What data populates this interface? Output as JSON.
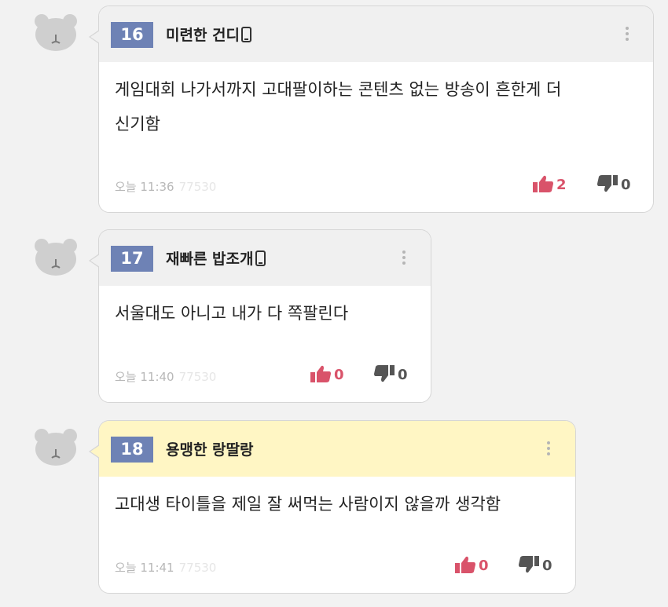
{
  "colors": {
    "number_badge": "#6e82b5",
    "highlight": "#fff6c4",
    "like": "#d9536a",
    "dislike": "#555555"
  },
  "comments": [
    {
      "number": "16",
      "nickname": "미련한 건디",
      "mobile_icon": "phone-icon",
      "content_lines": [
        "게임대회 나가서까지 고대팔이하는 콘텐츠 없는 방송이 흔한게 더",
        "신기함"
      ],
      "time": "오늘 11:36",
      "hits": "77530",
      "likes": "2",
      "dislikes": "0"
    },
    {
      "number": "17",
      "nickname": "재빠른 밥조개",
      "mobile_icon": "phone-icon",
      "content_lines": [
        "서울대도 아니고 내가 다 쪽팔린다"
      ],
      "time": "오늘 11:40",
      "hits": "77530",
      "likes": "0",
      "dislikes": "0"
    },
    {
      "number": "18",
      "nickname": "용맹한 랑딸랑",
      "content_lines": [
        "고대생 타이틀을 제일 잘 써먹는 사람이지 않을까 생각함"
      ],
      "time": "오늘 11:41",
      "hits": "77530",
      "likes": "0",
      "dislikes": "0"
    }
  ]
}
